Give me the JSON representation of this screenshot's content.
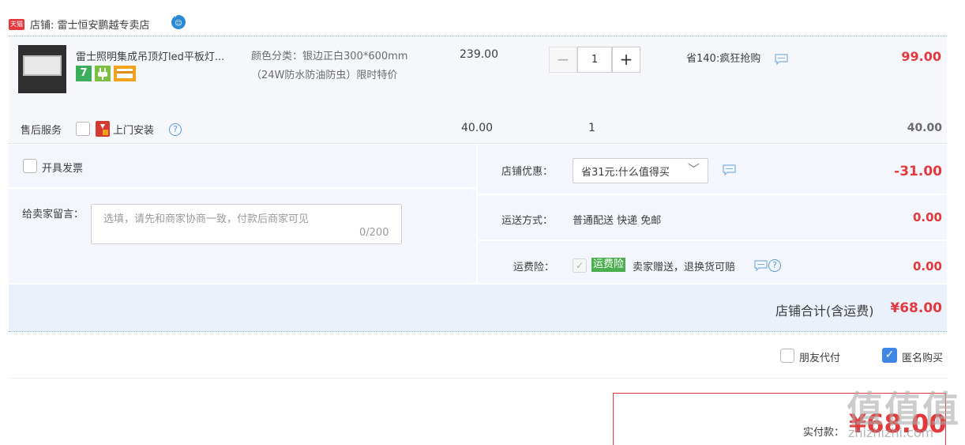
{
  "shop": {
    "badge": "天猫",
    "label": "店铺: 雷士恒安鹏越专卖店",
    "ww_icon": "wangwang-chat-icon"
  },
  "item": {
    "title": "雷士照明集成吊顶灯led平板灯...",
    "tag_number": "7",
    "sku": "颜色分类：银边正白300*600mm（24W防水防油防虫）限时特价",
    "unit_price": "239.00",
    "quantity": "1",
    "qty_minus": "−",
    "qty_plus": "+",
    "promo": "省140:疯狂抢购",
    "total": "99.00"
  },
  "service": {
    "label": "售后服务",
    "name": "上门安装",
    "help": "?",
    "price": "40.00",
    "quantity": "1",
    "total": "40.00"
  },
  "invoice": {
    "label": "开具发票"
  },
  "message": {
    "label": "给卖家留言：",
    "placeholder": "选填，请先和商家协商一致，付款后商家可见",
    "count": "0/200"
  },
  "discount": {
    "label": "店铺优惠：",
    "selected": "省31元:什么值得买",
    "caret": "﹀",
    "amount": "-31.00"
  },
  "shipping": {
    "label": "运送方式：",
    "method": "普通配送 快递 免邮",
    "amount": "0.00"
  },
  "insurance": {
    "label": "运费险：",
    "badge": "运费险",
    "desc": "卖家赠送，退换货可赔",
    "help": "?",
    "amount": "0.00"
  },
  "shop_total": {
    "label": "店铺合计(含运费)",
    "amount": "¥68.00"
  },
  "options": {
    "friend_pay": "朋友代付",
    "anonymous": "匿名购买",
    "check": "✓"
  },
  "payment": {
    "label": "实付款：",
    "amount": "¥68.00"
  },
  "watermark": {
    "logo": "值值值",
    "site": "zhizhizhi.com"
  },
  "colors": {
    "accent_red": "#e4393c",
    "link_blue": "#3f87e5",
    "panel_bg": "#f3f7fd"
  }
}
